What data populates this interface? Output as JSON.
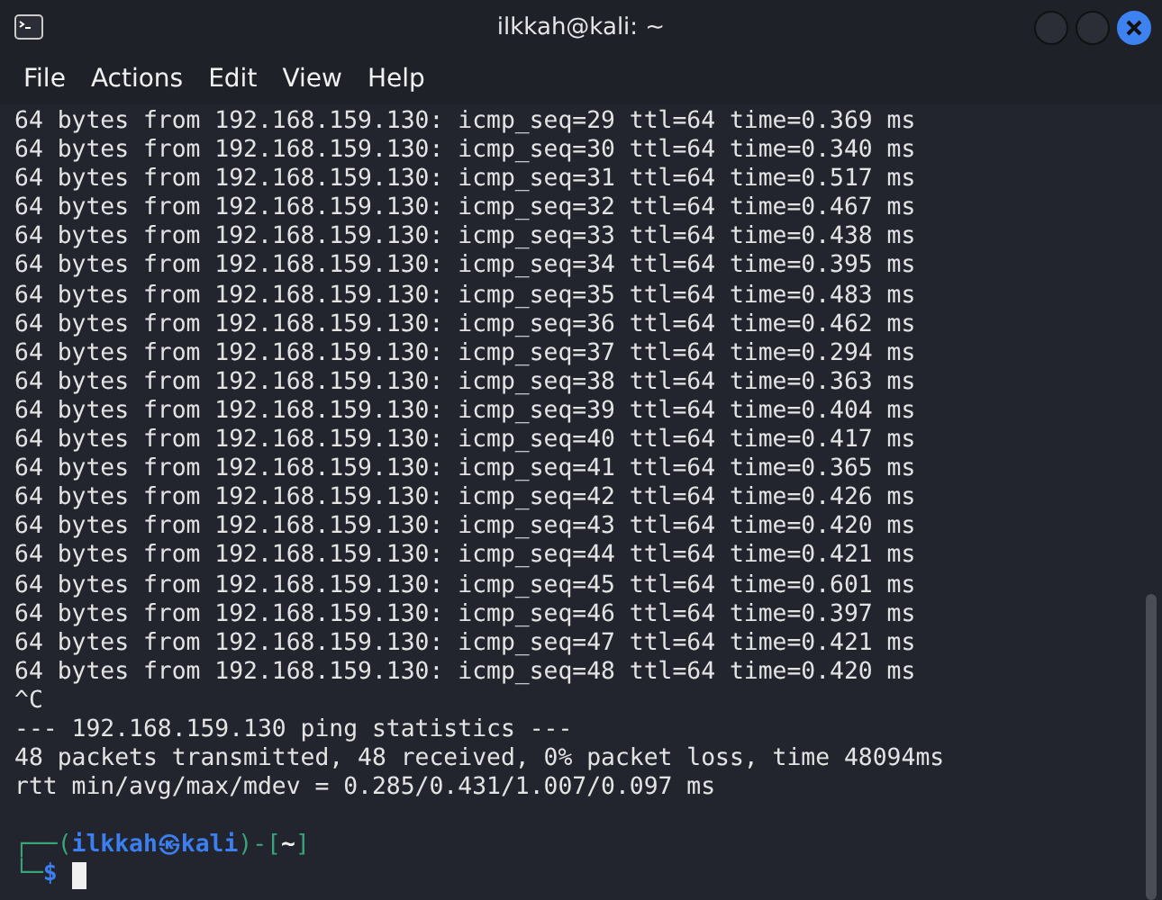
{
  "window": {
    "title": "ilkkah@kali: ~"
  },
  "menu": [
    "File",
    "Actions",
    "Edit",
    "View",
    "Help"
  ],
  "terminal": {
    "lines": [
      "64 bytes from 192.168.159.130: icmp_seq=29 ttl=64 time=0.369 ms",
      "64 bytes from 192.168.159.130: icmp_seq=30 ttl=64 time=0.340 ms",
      "64 bytes from 192.168.159.130: icmp_seq=31 ttl=64 time=0.517 ms",
      "64 bytes from 192.168.159.130: icmp_seq=32 ttl=64 time=0.467 ms",
      "64 bytes from 192.168.159.130: icmp_seq=33 ttl=64 time=0.438 ms",
      "64 bytes from 192.168.159.130: icmp_seq=34 ttl=64 time=0.395 ms",
      "64 bytes from 192.168.159.130: icmp_seq=35 ttl=64 time=0.483 ms",
      "64 bytes from 192.168.159.130: icmp_seq=36 ttl=64 time=0.462 ms",
      "64 bytes from 192.168.159.130: icmp_seq=37 ttl=64 time=0.294 ms",
      "64 bytes from 192.168.159.130: icmp_seq=38 ttl=64 time=0.363 ms",
      "64 bytes from 192.168.159.130: icmp_seq=39 ttl=64 time=0.404 ms",
      "64 bytes from 192.168.159.130: icmp_seq=40 ttl=64 time=0.417 ms",
      "64 bytes from 192.168.159.130: icmp_seq=41 ttl=64 time=0.365 ms",
      "64 bytes from 192.168.159.130: icmp_seq=42 ttl=64 time=0.426 ms",
      "64 bytes from 192.168.159.130: icmp_seq=43 ttl=64 time=0.420 ms",
      "64 bytes from 192.168.159.130: icmp_seq=44 ttl=64 time=0.421 ms",
      "64 bytes from 192.168.159.130: icmp_seq=45 ttl=64 time=0.601 ms",
      "64 bytes from 192.168.159.130: icmp_seq=46 ttl=64 time=0.397 ms",
      "64 bytes from 192.168.159.130: icmp_seq=47 ttl=64 time=0.421 ms",
      "64 bytes from 192.168.159.130: icmp_seq=48 ttl=64 time=0.420 ms",
      "^C",
      "--- 192.168.159.130 ping statistics ---",
      "48 packets transmitted, 48 received, 0% packet loss, time 48094ms",
      "rtt min/avg/max/mdev = 0.285/0.431/1.007/0.097 ms"
    ],
    "prompt": [
      [
        {
          "kind": "frame",
          "text": "┌──("
        },
        {
          "kind": "user",
          "text": "ilkkah㉿kali"
        },
        {
          "kind": "frame",
          "text": ")-["
        },
        {
          "kind": "cwd",
          "text": "~"
        },
        {
          "kind": "frame",
          "text": "]"
        }
      ],
      [
        {
          "kind": "frame",
          "text": "└─"
        },
        {
          "kind": "user",
          "text": "$"
        }
      ]
    ]
  }
}
